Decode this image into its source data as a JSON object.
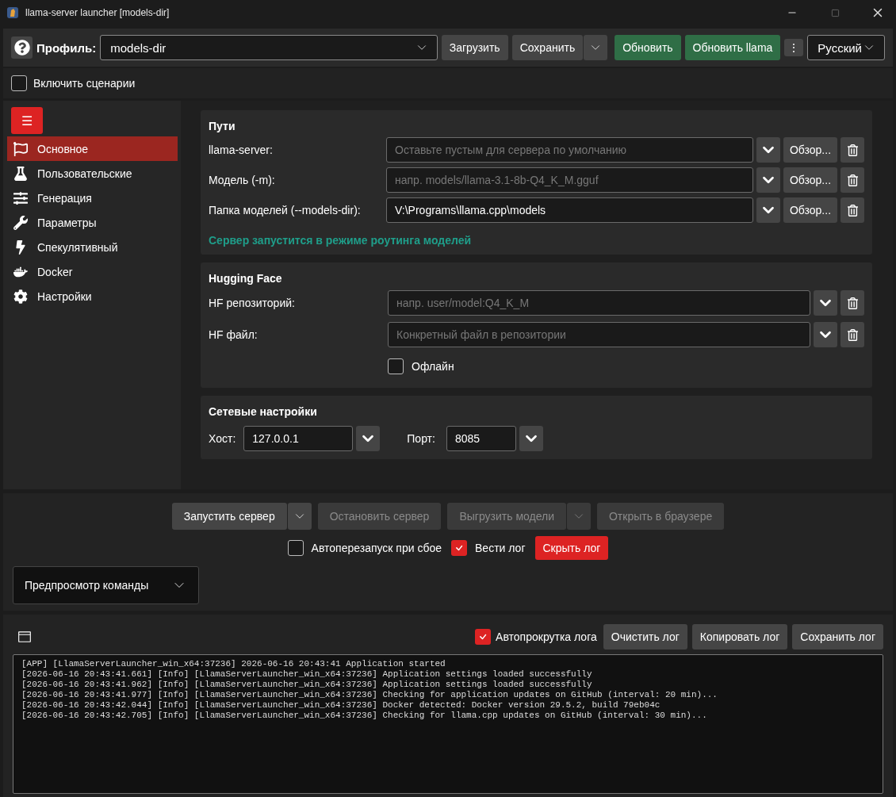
{
  "window": {
    "title": "llama-server launcher [models-dir]"
  },
  "toolbar": {
    "profile_label": "Профиль:",
    "profile_value": "models-dir",
    "load_button": "Загрузить",
    "save_button": "Сохранить",
    "update_button": "Обновить",
    "update_llama_button": "Обновить llama",
    "more_button": "⋮",
    "language": "Русский"
  },
  "scenarios": {
    "label": "Включить сценарии",
    "checked": false
  },
  "sidebar": {
    "menu_button": "☰",
    "items": [
      {
        "label": "Основное",
        "selected": true
      },
      {
        "label": "Пользовательские",
        "selected": false
      },
      {
        "label": "Генерация",
        "selected": false
      },
      {
        "label": "Параметры",
        "selected": false
      },
      {
        "label": "Спекулятивный",
        "selected": false
      },
      {
        "label": "Docker",
        "selected": false
      },
      {
        "label": "Настройки",
        "selected": false
      }
    ]
  },
  "paths": {
    "title": "Пути",
    "rows": [
      {
        "label": "llama-server:",
        "placeholder": "Оставьте пустым для сервера по умолчанию",
        "browse": "Обзор..."
      },
      {
        "label": "Модель (-m):",
        "placeholder": "напр. models/llama-3.1-8b-Q4_K_M.gguf",
        "browse": "Обзор..."
      },
      {
        "label": "Папка моделей (--models-dir):",
        "value": "V:\\Programs\\llama.cpp\\models",
        "browse": "Обзор..."
      }
    ],
    "note": "Сервер запустится в режиме роутинга моделей"
  },
  "hugging_face": {
    "title": "Hugging Face",
    "rows": [
      {
        "label": "HF репозиторий:",
        "placeholder": "напр. user/model:Q4_K_M"
      },
      {
        "label": "HF файл:",
        "placeholder": "Конкретный файл в репозитории"
      }
    ],
    "offline": {
      "label": "Офлайн",
      "checked": false
    }
  },
  "network": {
    "title": "Сетевые настройки",
    "host_label": "Хост:",
    "host": "127.0.0.1",
    "port_label": "Порт:",
    "port": "8085"
  },
  "actions": [
    {
      "label": "Запустить сервер",
      "disabled": false,
      "split": true
    },
    {
      "label": "Остановить сервер",
      "disabled": true,
      "split": false
    },
    {
      "label": "Выгрузить модели",
      "disabled": true,
      "split": true
    },
    {
      "label": "Открыть в браузере",
      "disabled": true,
      "split": false
    }
  ],
  "options": [
    {
      "label": "Автоперезапуск при сбое",
      "checked": false
    },
    {
      "label": "Вести лог",
      "checked": true
    }
  ],
  "hide_log_button": "Скрыть лог",
  "command_preview": "Предпросмотр команды",
  "log": {
    "autoscroll": {
      "label": "Автопрокрутка лога",
      "checked": true
    },
    "buttons": [
      "Очистить лог",
      "Копировать лог",
      "Сохранить лог"
    ],
    "lines": [
      "[APP] [LlamaServerLauncher_win_x64:37236] 2026-06-16 20:43:41 Application started",
      "[2026-06-16 20:43:41.661] [Info] [LlamaServerLauncher_win_x64:37236] Application settings loaded successfully",
      "[2026-06-16 20:43:41.962] [Info] [LlamaServerLauncher_win_x64:37236] Application settings loaded successfully",
      "[2026-06-16 20:43:41.977] [Info] [LlamaServerLauncher_win_x64:37236] Checking for application updates on GitHub (interval: 20 min)...",
      "[2026-06-16 20:43:42.044] [Info] [LlamaServerLauncher_win_x64:37236] Docker detected: Docker version 29.5.2, build 79eb04c",
      "[2026-06-16 20:43:42.705] [Info] [LlamaServerLauncher_win_x64:37236] Checking for llama.cpp updates on GitHub (interval: 30 min)..."
    ]
  }
}
